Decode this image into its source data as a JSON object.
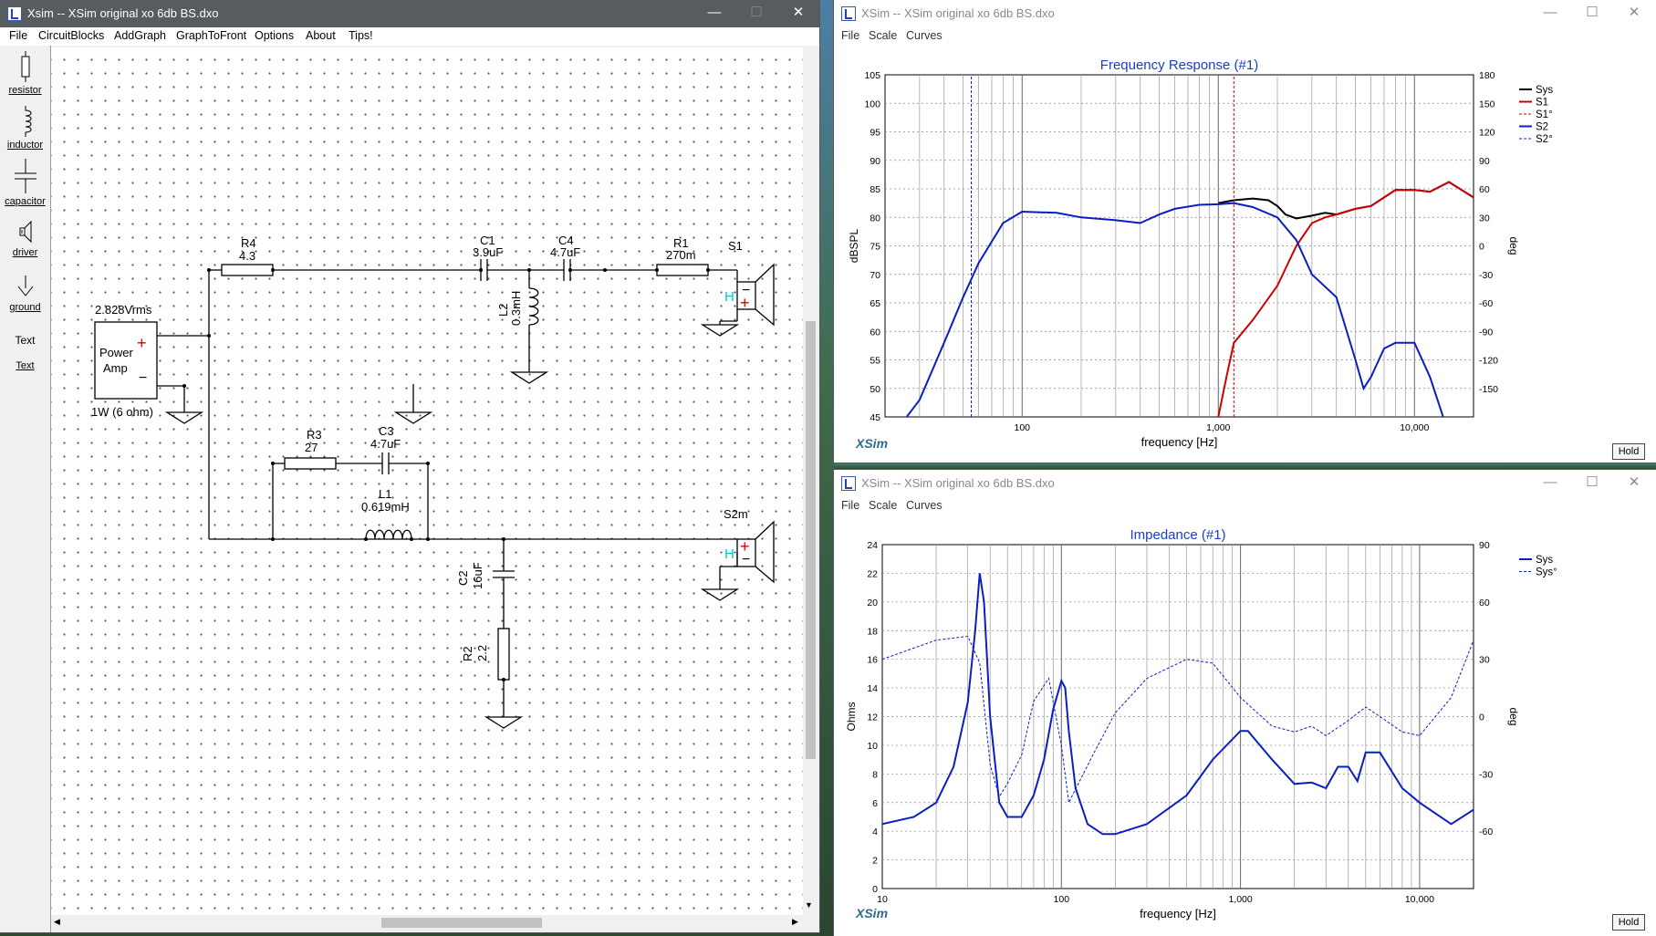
{
  "editor_window": {
    "title": "Xsim -- XSim original xo 6db BS.dxo",
    "menu": [
      "File",
      "CircuitBlocks",
      "AddGraph",
      "GraphToFront",
      "Options",
      "About",
      "Tips!"
    ],
    "tools": [
      {
        "label": "resistor",
        "icon": "resistor-icon"
      },
      {
        "label": "inductor",
        "icon": "inductor-icon"
      },
      {
        "label": "capacitor",
        "icon": "capacitor-icon"
      },
      {
        "label": "driver",
        "icon": "driver-icon"
      },
      {
        "label": "ground",
        "icon": "ground-icon"
      },
      {
        "label": "Text",
        "icon": "text-icon"
      },
      {
        "label": "Text",
        "icon": "text-link"
      }
    ]
  },
  "schematic": {
    "source": {
      "voltage": "2.828Vrms",
      "line1": "Power",
      "line2": "Amp",
      "plus": "+",
      "minus": "−",
      "rating": "1W (6 ohm)"
    },
    "components": {
      "R4": {
        "name": "R4",
        "value": "4.3"
      },
      "C1": {
        "name": "C1",
        "value": "3.9uF"
      },
      "C4": {
        "name": "C4",
        "value": "4.7uF"
      },
      "R1": {
        "name": "R1",
        "value": "270m"
      },
      "L2": {
        "name": "L2",
        "value": "0.3mH"
      },
      "R3": {
        "name": "R3",
        "value": "27"
      },
      "C3": {
        "name": "C3",
        "value": "4.7uF"
      },
      "L1": {
        "name": "L1",
        "value": "0.619mH"
      },
      "C2": {
        "name": "C2",
        "value": "16uF"
      },
      "R2": {
        "name": "R2",
        "value": "2.2"
      }
    },
    "drivers": {
      "S1": {
        "name": "S1",
        "h": "H",
        "plus": "+",
        "minus": "−"
      },
      "S2m": {
        "name": "S2m",
        "h": "H",
        "plus": "+",
        "minus": "−"
      }
    }
  },
  "fr_window": {
    "title": "XSim -- XSim original xo 6db BS.dxo",
    "menu": [
      "File",
      "Scale",
      "Curves"
    ],
    "hold": "Hold",
    "brand": "XSim"
  },
  "imp_window": {
    "title": "XSim -- XSim original xo 6db BS.dxo",
    "menu": [
      "File",
      "Scale",
      "Curves"
    ],
    "hold": "Hold",
    "brand": "XSim"
  },
  "chart_data": [
    {
      "type": "line",
      "title": "Frequency Response (#1)",
      "xlabel": "frequency [Hz]",
      "ylabel": "dBSPL",
      "y2label": "deg",
      "xscale": "log",
      "xlim": [
        20,
        20000
      ],
      "ylim": [
        45,
        105
      ],
      "y2lim": [
        -180,
        180
      ],
      "xticks": [
        "100",
        "1,000",
        "10,000"
      ],
      "yticks": [
        "45",
        "50",
        "55",
        "60",
        "65",
        "70",
        "75",
        "80",
        "85",
        "90",
        "95",
        "100",
        "105"
      ],
      "y2ticks": [
        "-150",
        "-120",
        "-90",
        "-60",
        "-30",
        "0",
        "30",
        "60",
        "90",
        "120",
        "150",
        "180"
      ],
      "grid": true,
      "legend_position": "top-right",
      "series": [
        {
          "name": "Sys",
          "color": "#000000",
          "style": "solid",
          "axis": "left",
          "x": [
            1000,
            1200,
            1500,
            1800,
            2000,
            2200,
            2500,
            3000,
            3500,
            4000,
            5000,
            6000,
            8000,
            10000,
            12000,
            15000,
            20000
          ],
          "y": [
            82.5,
            83,
            83.3,
            83,
            82,
            80.5,
            79.8,
            80.3,
            80.8,
            80.5,
            81.5,
            82,
            84.8,
            84.8,
            84.5,
            86.2,
            83.5
          ]
        },
        {
          "name": "S1",
          "color": "#cc0000",
          "style": "solid",
          "axis": "left",
          "x": [
            1000,
            1100,
            1200,
            1500,
            2000,
            2500,
            3000,
            3500,
            4000,
            5000,
            6000,
            8000,
            10000,
            12000,
            15000,
            20000
          ],
          "y": [
            45,
            52,
            58,
            62,
            68,
            75,
            79,
            80,
            80.5,
            81.5,
            82,
            84.8,
            84.8,
            84.5,
            86.2,
            83.5
          ]
        },
        {
          "name": "S1°",
          "color": "#cc0000",
          "style": "dashed",
          "axis": "right",
          "x": [
            1200,
            1200
          ],
          "y": [
            -180,
            180
          ]
        },
        {
          "name": "S2",
          "color": "#0a1fbf",
          "style": "solid",
          "axis": "left",
          "x": [
            20,
            30,
            40,
            50,
            60,
            80,
            100,
            150,
            200,
            300,
            400,
            500,
            600,
            800,
            1000,
            1200,
            1500,
            2000,
            2500,
            3000,
            4000,
            5000,
            5500,
            6000,
            7000,
            8000,
            10000,
            12000,
            14000
          ],
          "y": [
            40,
            48,
            58,
            66,
            72,
            79,
            81,
            80.8,
            80,
            79.5,
            79,
            80.5,
            81.5,
            82.2,
            82.3,
            82.5,
            81.8,
            80,
            76,
            70,
            66,
            55,
            50,
            52,
            57,
            58,
            58,
            52,
            45
          ]
        },
        {
          "name": "S2°",
          "color": "#0a1fbf",
          "style": "dashed",
          "axis": "right",
          "x": [
            55,
            55
          ],
          "y": [
            -180,
            180
          ]
        }
      ]
    },
    {
      "type": "line",
      "title": "Impedance (#1)",
      "xlabel": "frequency [Hz]",
      "ylabel": "Ohms",
      "y2label": "deg",
      "xscale": "log",
      "xlim": [
        10,
        20000
      ],
      "ylim": [
        0,
        24
      ],
      "y2lim": [
        -90,
        90
      ],
      "xticks": [
        "10",
        "100",
        "1,000",
        "10,000"
      ],
      "yticks": [
        "0",
        "2",
        "4",
        "6",
        "8",
        "10",
        "12",
        "14",
        "16",
        "18",
        "20",
        "22",
        "24"
      ],
      "y2ticks": [
        "-60",
        "-30",
        "0",
        "30",
        "60",
        "90"
      ],
      "grid": true,
      "legend_position": "top-right",
      "series": [
        {
          "name": "Sys",
          "color": "#0a1fbf",
          "style": "solid",
          "axis": "left",
          "x": [
            10,
            15,
            20,
            25,
            30,
            33,
            35,
            37,
            40,
            45,
            50,
            60,
            70,
            80,
            90,
            100,
            105,
            110,
            120,
            140,
            170,
            200,
            300,
            500,
            700,
            1000,
            1100,
            1500,
            2000,
            2500,
            3000,
            3500,
            4000,
            4500,
            5000,
            6000,
            8000,
            10000,
            15000,
            20000
          ],
          "y": [
            4.5,
            5,
            6,
            8.5,
            13,
            18,
            22,
            20,
            12,
            6,
            5,
            5,
            6.5,
            9,
            12.5,
            14.5,
            14,
            11,
            7,
            4.5,
            3.8,
            3.8,
            4.5,
            6.5,
            9,
            11,
            11,
            9,
            7.3,
            7.4,
            7,
            8.5,
            8.5,
            7.5,
            9.5,
            9.5,
            7,
            6,
            4.5,
            5.5
          ]
        },
        {
          "name": "Sys°",
          "color": "#0a1fbf",
          "style": "dashed",
          "axis": "right",
          "x": [
            10,
            20,
            30,
            35,
            40,
            45,
            50,
            60,
            70,
            85,
            100,
            110,
            120,
            150,
            200,
            300,
            500,
            700,
            1000,
            1500,
            2000,
            2500,
            3000,
            4000,
            5000,
            6000,
            8000,
            10000,
            15000,
            20000
          ],
          "y": [
            30,
            40,
            42,
            28,
            -25,
            -42,
            -35,
            -20,
            8,
            20,
            -15,
            -45,
            -38,
            -20,
            2,
            20,
            30,
            28,
            10,
            -5,
            -8,
            -5,
            -10,
            -2,
            5,
            0,
            -8,
            -10,
            10,
            40
          ]
        }
      ]
    }
  ]
}
